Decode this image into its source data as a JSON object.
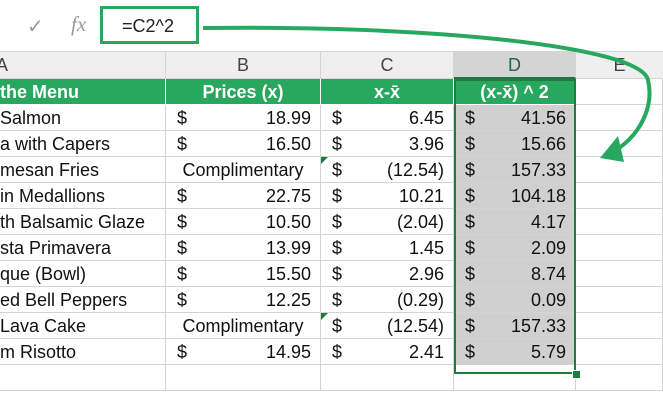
{
  "formula_bar": {
    "check_icon": "check-icon",
    "fx_label": "fx",
    "formula": "=C2^2"
  },
  "column_headers": [
    "A",
    "B",
    "C",
    "D",
    "E"
  ],
  "header_row": [
    "the Menu",
    "Prices (x)",
    "x-x̄",
    "(x-x̄) ^ 2"
  ],
  "rows": [
    {
      "item": "Salmon",
      "price_sym": "$",
      "price": "18.99",
      "dev_sym": "$",
      "dev": "6.45",
      "sq_sym": "$",
      "sq": "41.56"
    },
    {
      "item": "a with Capers",
      "price_sym": "$",
      "price": "16.50",
      "dev_sym": "$",
      "dev": "3.96",
      "sq_sym": "$",
      "sq": "15.66"
    },
    {
      "item": "mesan Fries",
      "price_text": "Complimentary",
      "dev_sym": "$",
      "dev": "(12.54)",
      "sq_sym": "$",
      "sq": "157.33"
    },
    {
      "item": "in Medallions",
      "price_sym": "$",
      "price": "22.75",
      "dev_sym": "$",
      "dev": "10.21",
      "sq_sym": "$",
      "sq": "104.18"
    },
    {
      "item": "th Balsamic Glaze",
      "price_sym": "$",
      "price": "10.50",
      "dev_sym": "$",
      "dev": "(2.04)",
      "sq_sym": "$",
      "sq": "4.17"
    },
    {
      "item": "sta Primavera",
      "price_sym": "$",
      "price": "13.99",
      "dev_sym": "$",
      "dev": "1.45",
      "sq_sym": "$",
      "sq": "2.09"
    },
    {
      "item": "que (Bowl)",
      "price_sym": "$",
      "price": "15.50",
      "dev_sym": "$",
      "dev": "2.96",
      "sq_sym": "$",
      "sq": "8.74"
    },
    {
      "item": "ed Bell Peppers",
      "price_sym": "$",
      "price": "12.25",
      "dev_sym": "$",
      "dev": "(0.29)",
      "sq_sym": "$",
      "sq": "0.09"
    },
    {
      "item": "Lava Cake",
      "price_text": "Complimentary",
      "dev_sym": "$",
      "dev": "(12.54)",
      "sq_sym": "$",
      "sq": "157.33"
    },
    {
      "item": "m Risotto",
      "price_sym": "$",
      "price": "14.95",
      "dev_sym": "$",
      "dev": "2.41",
      "sq_sym": "$",
      "sq": "5.79"
    }
  ],
  "colors": {
    "header_green": "#27a85e",
    "selection_green": "#1e7d3e",
    "selected_fill": "#d0d0d0"
  }
}
